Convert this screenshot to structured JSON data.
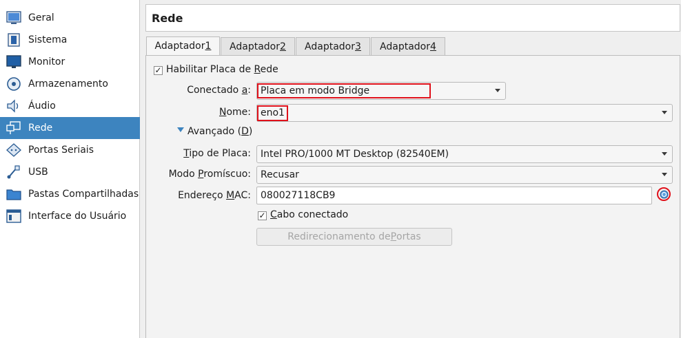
{
  "sidebar": {
    "items": [
      {
        "label": "Geral",
        "icon": "general-icon"
      },
      {
        "label": "Sistema",
        "icon": "system-icon"
      },
      {
        "label": "Monitor",
        "icon": "monitor-icon"
      },
      {
        "label": "Armazenamento",
        "icon": "storage-icon"
      },
      {
        "label": "Áudio",
        "icon": "audio-icon"
      },
      {
        "label": "Rede",
        "icon": "network-icon",
        "active": true
      },
      {
        "label": "Portas Seriais",
        "icon": "serial-ports-icon"
      },
      {
        "label": "USB",
        "icon": "usb-icon"
      },
      {
        "label": "Pastas Compartilhadas",
        "icon": "shared-folders-icon"
      },
      {
        "label": "Interface do Usuário",
        "icon": "user-interface-icon"
      }
    ]
  },
  "header": {
    "title": "Rede"
  },
  "tabs": [
    {
      "label": "Adaptador ",
      "key": "1"
    },
    {
      "label": "Adaptador ",
      "key": "2"
    },
    {
      "label": "Adaptador ",
      "key": "3"
    },
    {
      "label": "Adaptador ",
      "key": "4"
    }
  ],
  "form": {
    "enable_pre": "Habilitar Placa de ",
    "enable_key": "R",
    "enable_post": "ede",
    "attached_pre": "Conectado ",
    "attached_key": "a",
    "attached_post": ":",
    "attached_value": "Placa em modo Bridge",
    "name_key": "N",
    "name_post": "ome:",
    "name_value": "eno1",
    "advanced_pre": "Avançado (",
    "advanced_key": "D",
    "advanced_post": ")",
    "type_key": "T",
    "type_post": "ipo de Placa:",
    "type_value": "Intel PRO/1000 MT Desktop (82540EM)",
    "promisc_pre": "Modo ",
    "promisc_key": "P",
    "promisc_post": "romíscuo:",
    "promisc_value": "Recusar",
    "mac_pre": "Endereço ",
    "mac_key": "M",
    "mac_post": "AC:",
    "mac_value": "080027118CB9",
    "cable_pre": "",
    "cable_key": "C",
    "cable_post": "abo conectado",
    "portfwd_pre": "Redirecionamento de ",
    "portfwd_key": "P",
    "portfwd_post": "ortas"
  },
  "colors": {
    "accent": "#3d84bf",
    "highlight": "#e0111b"
  }
}
